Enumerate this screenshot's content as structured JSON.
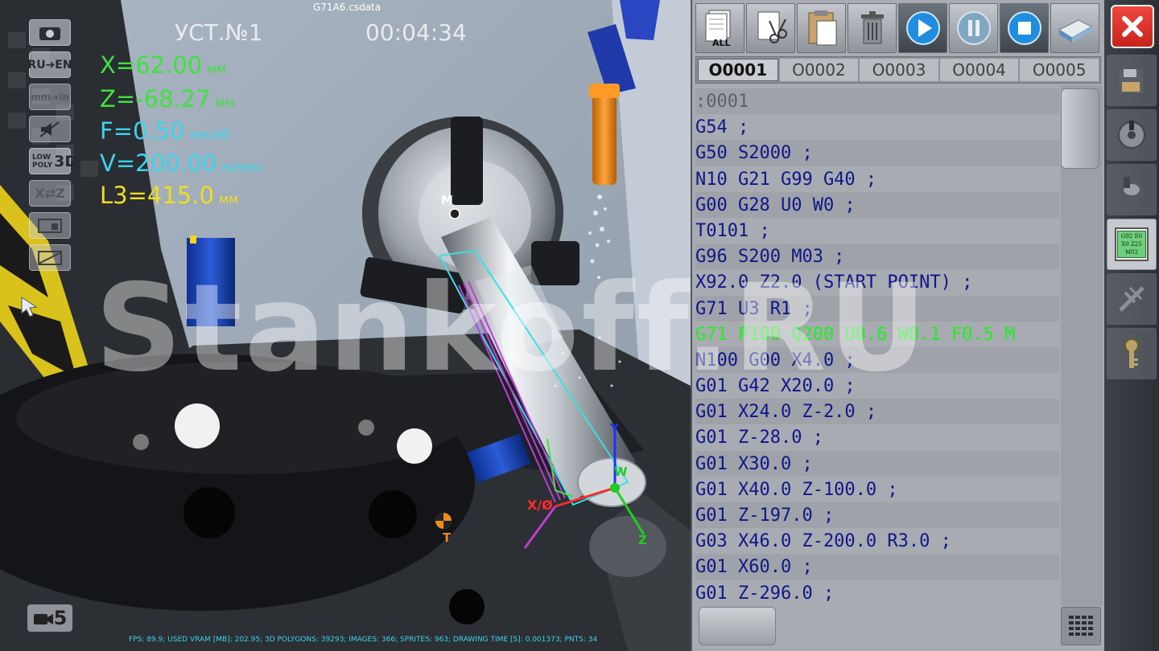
{
  "file_title": "G71A6.csdata",
  "setup_label": "УСТ.№1",
  "timer": "00:04:34",
  "readouts": {
    "x": {
      "value": "X=62.00",
      "unit": "мм"
    },
    "z": {
      "value": "Z=-68.27",
      "unit": "мм"
    },
    "f": {
      "value": "F=0.50",
      "unit": "мм/об"
    },
    "v": {
      "value": "V=200.00",
      "unit": "м/мин"
    },
    "l3": {
      "value": "L3=415.0",
      "unit": "мм"
    }
  },
  "left_buttons": {
    "lang": "RU➔EN",
    "units": "mm➔in",
    "poly_top": "LOW",
    "poly_mid": "POLY",
    "poly_3d": "3D",
    "axis": "X⇄Z"
  },
  "camera_button": "5",
  "scene_labels": {
    "machine_zero": "M",
    "workpiece_zero": "W",
    "tool_point": "T",
    "axis_x": "X/Ø",
    "axis_y": "Y",
    "axis_z": "Z"
  },
  "watermark": "Stankoff.RU",
  "stats": "FPS: 89.9; USED VRAM [MB]: 202.95; 3D POLYGONS: 39293; IMAGES: 366; SPRITES: 963; DRAWING TIME [S]: 0.001373; PNTS: 34",
  "toolbar": {
    "select_all_label": "ALL"
  },
  "tabs": [
    {
      "label": "O0001",
      "active": true
    },
    {
      "label": "O0002",
      "active": false
    },
    {
      "label": "O0003",
      "active": false
    },
    {
      "label": "O0004",
      "active": false
    },
    {
      "label": "O0005",
      "active": false
    }
  ],
  "code_lines": [
    ":0001",
    "G54 ;",
    "G50 S2000 ;",
    "N10 G21 G99 G40 ;",
    "G00 G28 U0 W0 ;",
    "T0101 ;",
    "G96 S200 M03 ;",
    "X92.0 Z2.0 (START POINT) ;",
    "G71 U3 R1 ;",
    "G71 P100 Q200 U0.6 W0.1 F0.5 M",
    "N100 G00 X4.0 ;",
    "G01 G42 X20.0 ;",
    "G01 X24.0 Z-2.0 ;",
    "G01 Z-28.0 ;",
    "G01 X30.0 ;",
    "G01 X40.0 Z-100.0 ;",
    "G01 Z-197.0 ;",
    "G03 X46.0 Z-200.0 R3.0 ;",
    "G01 X60.0 ;",
    "G01 Z-296.0 ;"
  ],
  "active_line_index": 9,
  "sidebar": {
    "program_icon_lines": [
      "G92 E0",
      "X0 Z25",
      "M02"
    ]
  },
  "colors": {
    "coord_green": "#3ee23e",
    "coord_cyan": "#3ad4ee",
    "coord_yellow": "#eedd22",
    "code_blue": "#10168a",
    "active_line": "#22ee22",
    "close_red": "#e0342b"
  }
}
